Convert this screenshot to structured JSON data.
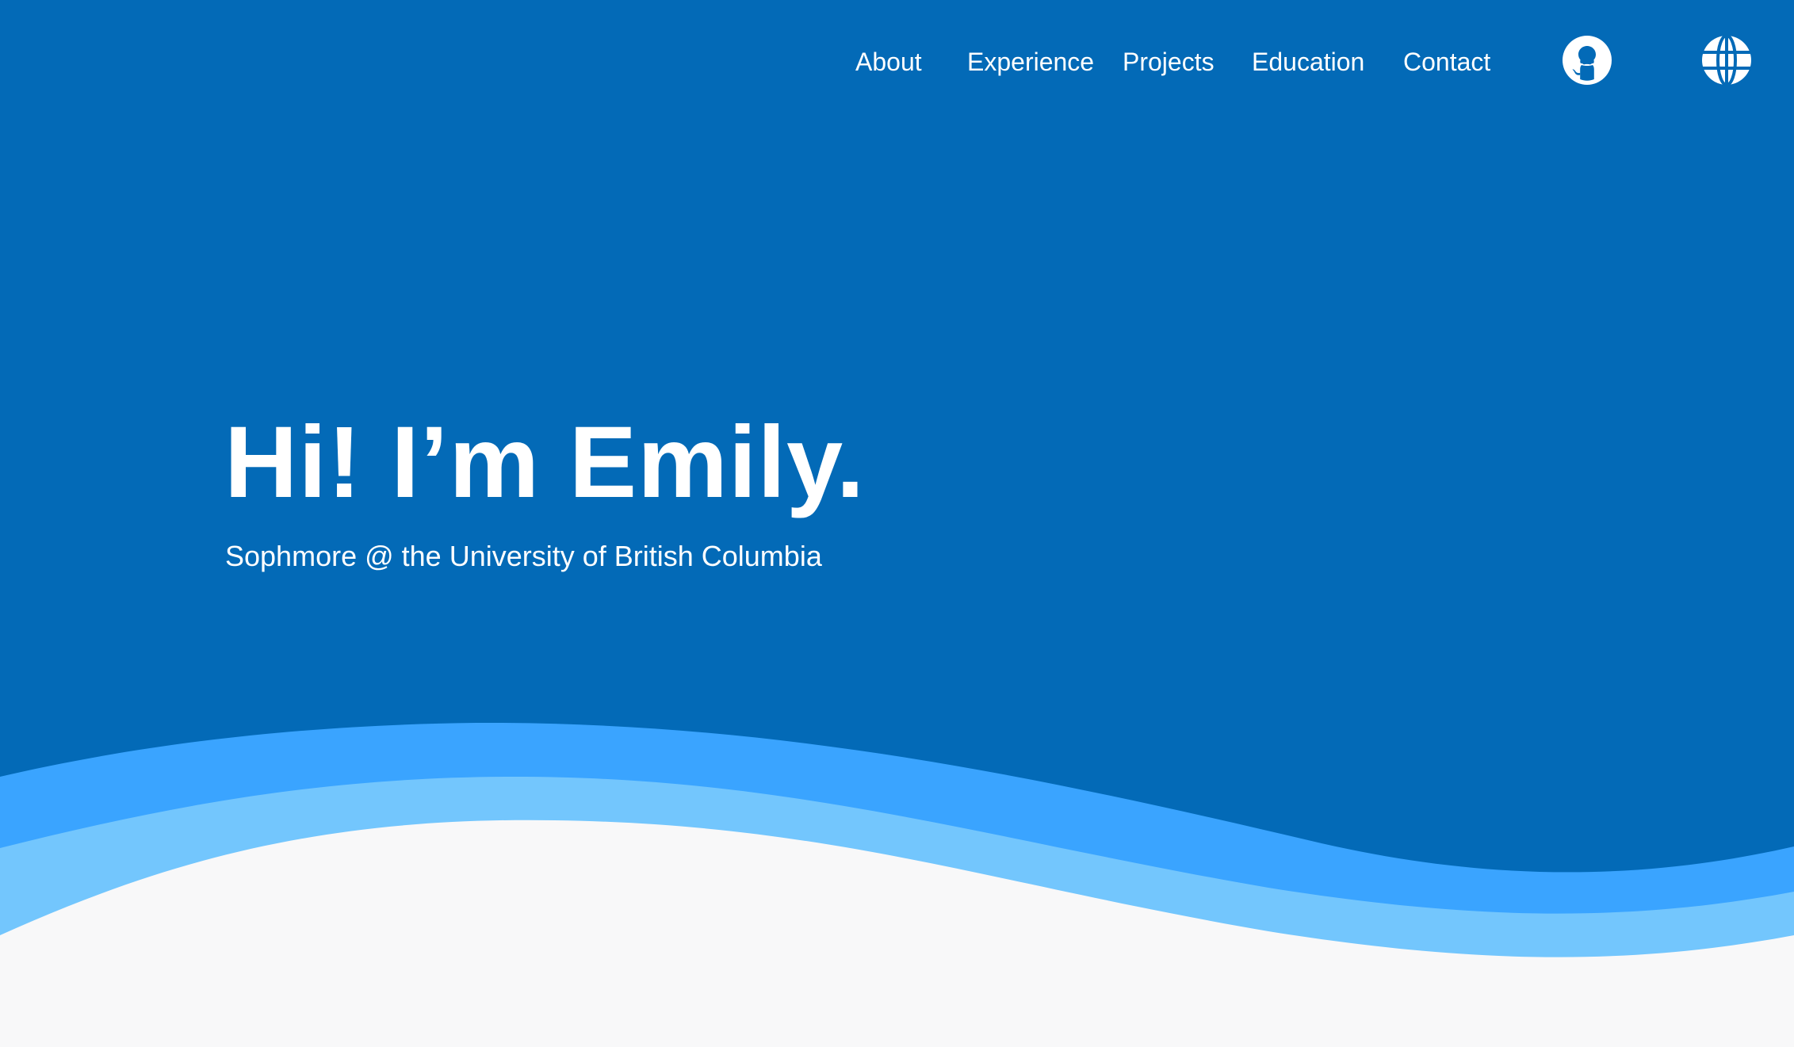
{
  "nav": {
    "items": [
      {
        "label": "About"
      },
      {
        "label": "Experience"
      },
      {
        "label": "Projects"
      },
      {
        "label": "Education"
      },
      {
        "label": "Contact"
      }
    ],
    "icons": [
      "github-icon",
      "globe-icon"
    ]
  },
  "hero": {
    "title": "Hi! I’m Emily.",
    "subtitle": "Sophmore @ the University of British Columbia"
  },
  "colors": {
    "primary_blue": "#036ab7",
    "wave_mid": "#3aa4ff",
    "wave_light": "#73c6fd",
    "background": "#f8f8f9",
    "text": "#ffffff"
  }
}
